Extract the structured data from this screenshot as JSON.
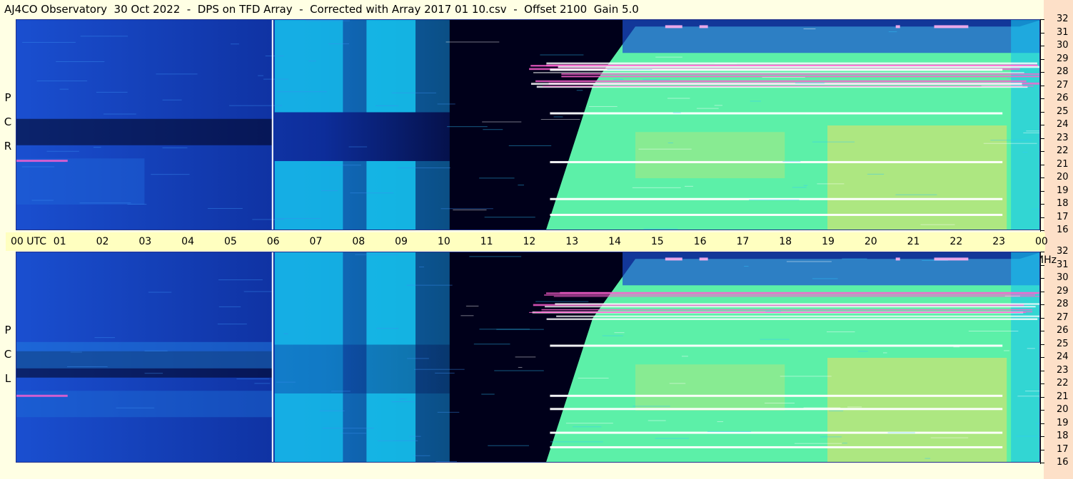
{
  "title": "AJ4CO Observatory  30 Oct 2022  -  DPS on TFD Array  -  Corrected with Array 2017 01 10.csv  -  Offset 2100  Gain 5.0",
  "utc_ticks": [
    "00  UTC",
    "01",
    "02",
    "03",
    "04",
    "05",
    "06",
    "07",
    "08",
    "09",
    "10",
    "11",
    "12",
    "13",
    "14",
    "15",
    "16",
    "17",
    "18",
    "19",
    "20",
    "21",
    "22",
    "23",
    "00 MHz"
  ],
  "panels": [
    {
      "polarization": "R C P",
      "letters": [
        "R",
        "C",
        "P"
      ]
    },
    {
      "polarization": "L C P",
      "letters": [
        "L",
        "C",
        "P"
      ]
    }
  ],
  "colors": {
    "background": "#ffffe4",
    "utc_bar": "#ffffc0",
    "quiet_dark": "#0a0f60",
    "night_black": "#00001a",
    "low_blue": "#1a4fd0",
    "cyan": "#16c4f0",
    "high_green": "#5cf0a8",
    "peak_yellow": "#f0e060",
    "interference": "#ff60d0"
  },
  "chart_data": {
    "type": "heatmap",
    "title": "AJ4CO Observatory  30 Oct 2022  -  DPS on TFD Array  -  Corrected with Array 2017 01 10.csv  -  Offset 2100  Gain 5.0",
    "xlabel": "UTC",
    "ylabel": "MHz",
    "x_ticks": [
      "00",
      "01",
      "02",
      "03",
      "04",
      "05",
      "06",
      "07",
      "08",
      "09",
      "10",
      "11",
      "12",
      "13",
      "14",
      "15",
      "16",
      "17",
      "18",
      "19",
      "20",
      "21",
      "22",
      "23",
      "00"
    ],
    "y_ticks": [
      16,
      17,
      18,
      19,
      20,
      21,
      22,
      23,
      24,
      25,
      26,
      27,
      28,
      29,
      30,
      31,
      32
    ],
    "xlim": [
      0,
      24
    ],
    "ylim": [
      16,
      32
    ],
    "panels": [
      "R C P",
      "L C P"
    ],
    "grid": false,
    "legend": "none"
  }
}
